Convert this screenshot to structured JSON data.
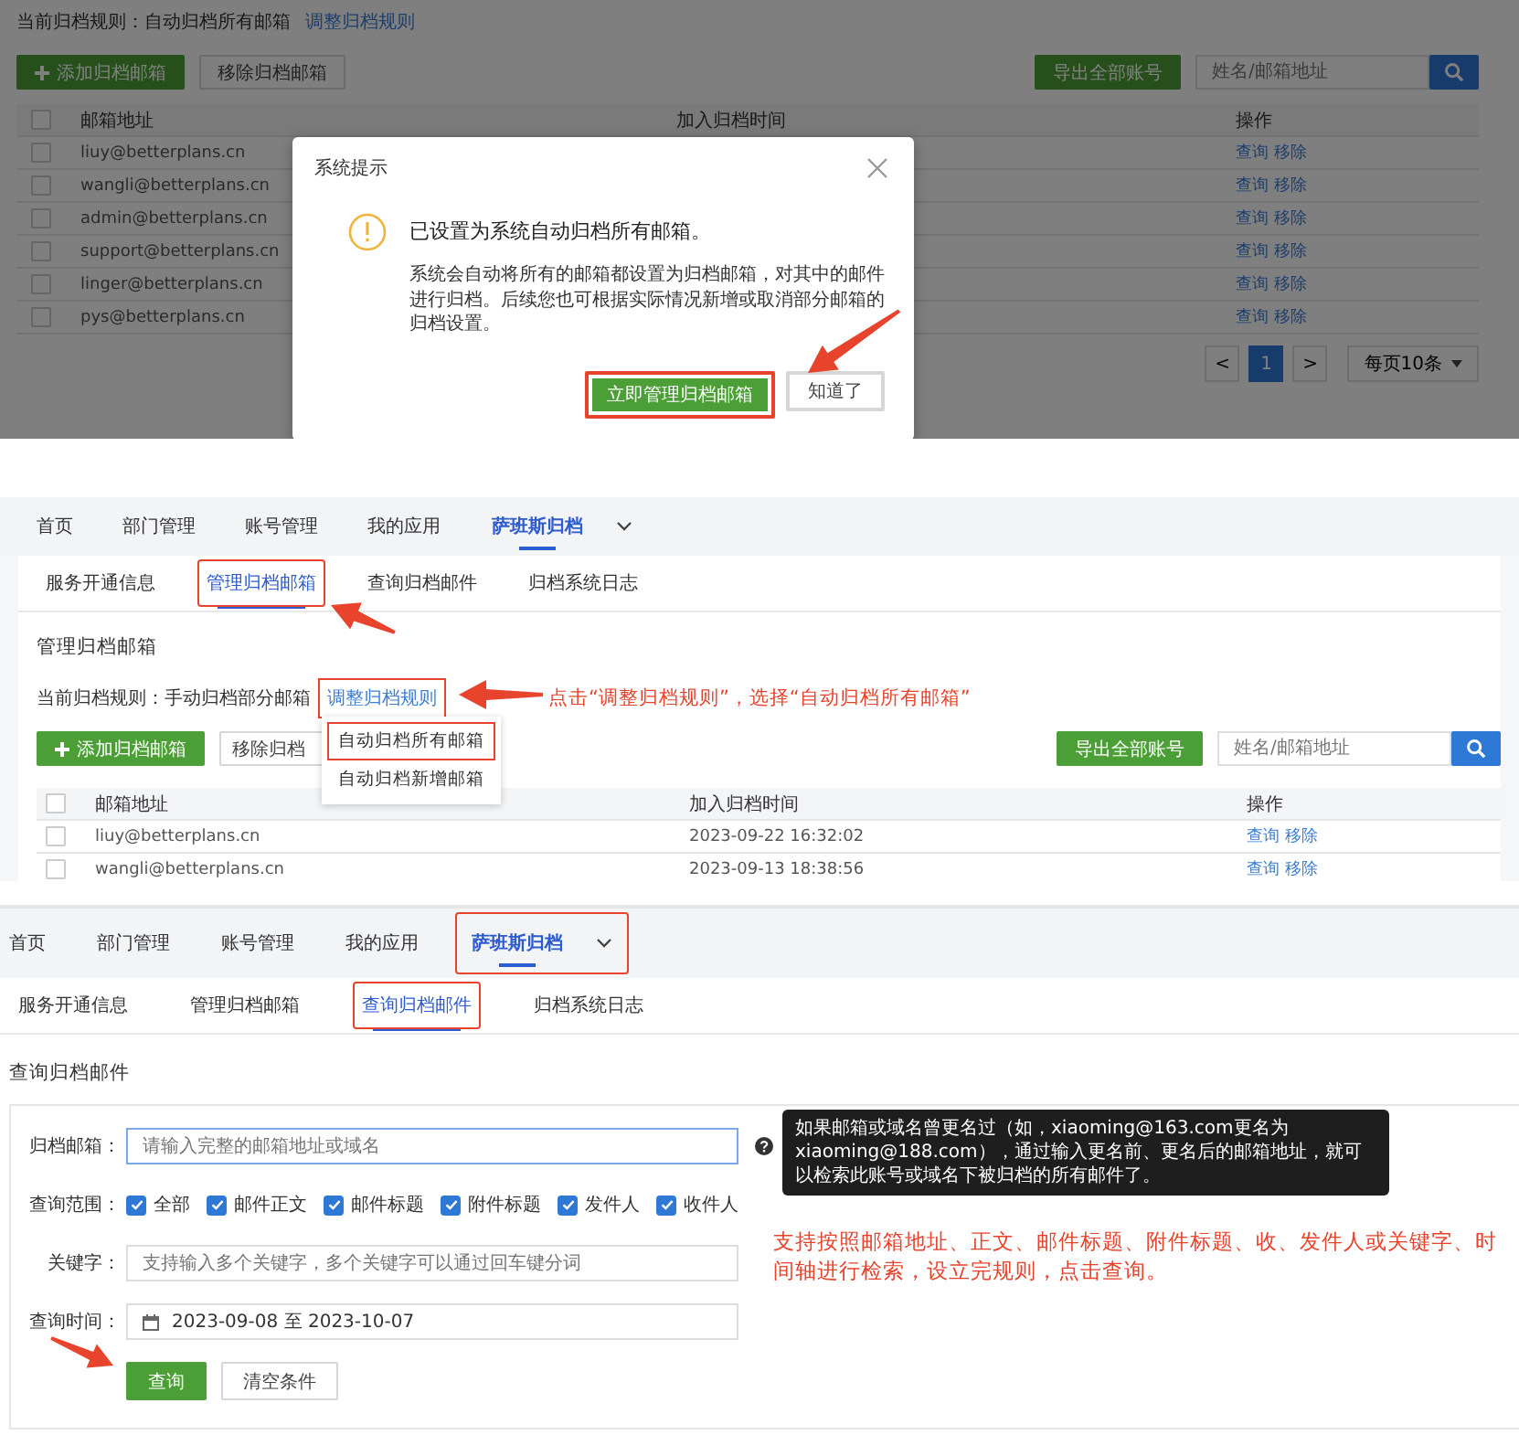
{
  "dialog_screen": {
    "rule": {
      "text": "当前归档规则：自动归档所有邮箱",
      "link": "调整归档规则"
    },
    "toolbar": {
      "add": "添加归档邮箱",
      "remove": "移除归档邮箱",
      "export": "导出全部账号",
      "search_placeholder": "姓名/邮箱地址"
    },
    "table": {
      "all_checked": false,
      "columns": [
        "邮箱地址",
        "加入归档时间",
        "操作"
      ],
      "rows": [
        {
          "checked": false,
          "email": "liuy@betterplans.cn",
          "actions": [
            "查询",
            "移除"
          ]
        },
        {
          "checked": false,
          "email": "wangli@betterplans.cn",
          "actions": [
            "查询",
            "移除"
          ]
        },
        {
          "checked": false,
          "email": "admin@betterplans.cn",
          "actions": [
            "查询",
            "移除"
          ]
        },
        {
          "checked": false,
          "email": "support@betterplans.cn",
          "actions": [
            "查询",
            "移除"
          ]
        },
        {
          "checked": false,
          "email": "linger@betterplans.cn",
          "actions": [
            "查询",
            "移除"
          ]
        },
        {
          "checked": false,
          "email": "pys@betterplans.cn",
          "actions": [
            "查询",
            "移除"
          ]
        }
      ]
    },
    "pagination": {
      "prev": "<",
      "pages": [
        {
          "label": "1",
          "selected": true
        }
      ],
      "next": ">",
      "page_size": "每页10条"
    },
    "dialog": {
      "title": "系统提示",
      "heading": "已设置为系统自动归档所有邮箱。",
      "message": "系统会自动将所有的邮箱都设置为归档邮箱，对其中的邮件进行归档。后续您也可根据实际情况新增或取消部分邮箱的归档设置。",
      "buttons": [
        {
          "label": "立即管理归档邮箱",
          "kind": "primary",
          "highlighted": true
        },
        {
          "label": "知道了",
          "kind": "default",
          "highlighted": false
        }
      ]
    }
  },
  "rule_screen": {
    "nav": {
      "tabs": [
        {
          "label": "首页",
          "selected": false
        },
        {
          "label": "部门管理",
          "selected": false
        },
        {
          "label": "账号管理",
          "selected": false
        },
        {
          "label": "我的应用",
          "selected": false
        },
        {
          "label": "萨班斯归档",
          "selected": true
        }
      ]
    },
    "subtabs": [
      {
        "label": "服务开通信息",
        "selected": false,
        "highlighted": false
      },
      {
        "label": "管理归档邮箱",
        "selected": true,
        "highlighted": true
      },
      {
        "label": "查询归档邮件",
        "selected": false,
        "highlighted": false
      },
      {
        "label": "归档系统日志",
        "selected": false,
        "highlighted": false
      }
    ],
    "heading": "管理归档邮箱",
    "rule": {
      "text": "当前归档规则：手动归档部分邮箱",
      "link": "调整归档规则",
      "link_highlighted": true
    },
    "annotation": "点击“调整归档规则”，选择“自动归档所有邮箱”",
    "dropdown": [
      {
        "label": "自动归档所有邮箱",
        "highlighted": true
      },
      {
        "label": "自动归档新增邮箱",
        "highlighted": false
      }
    ],
    "toolbar": {
      "add": "添加归档邮箱",
      "remove": "移除归档",
      "export": "导出全部账号",
      "search_placeholder": "姓名/邮箱地址"
    },
    "table": {
      "all_checked": false,
      "columns": [
        "邮箱地址",
        "加入归档时间",
        "操作"
      ],
      "rows": [
        {
          "checked": false,
          "email": "liuy@betterplans.cn",
          "time": "2023-09-22 16:32:02",
          "actions": [
            "查询",
            "移除"
          ]
        },
        {
          "checked": false,
          "email": "wangli@betterplans.cn",
          "time": "2023-09-13 18:38:56",
          "actions": [
            "查询",
            "移除"
          ]
        }
      ]
    }
  },
  "search_screen": {
    "nav": {
      "highlighted": true,
      "tabs": [
        {
          "label": "首页",
          "selected": false
        },
        {
          "label": "部门管理",
          "selected": false
        },
        {
          "label": "账号管理",
          "selected": false
        },
        {
          "label": "我的应用",
          "selected": false
        },
        {
          "label": "萨班斯归档",
          "selected": true
        }
      ]
    },
    "subtabs": [
      {
        "label": "服务开通信息",
        "selected": false,
        "highlighted": false
      },
      {
        "label": "管理归档邮箱",
        "selected": false,
        "highlighted": false
      },
      {
        "label": "查询归档邮件",
        "selected": true,
        "highlighted": true
      },
      {
        "label": "归档系统日志",
        "selected": false,
        "highlighted": false
      }
    ],
    "heading": "查询归档邮件",
    "form": {
      "rows": [
        {
          "kind": "input",
          "label": "归档邮箱：",
          "placeholder": "请输入完整的邮箱地址或域名",
          "help": true
        },
        {
          "kind": "checks",
          "label": "查询范围：",
          "options": [
            {
              "label": "全部",
              "checked": true
            },
            {
              "label": "邮件正文",
              "checked": true
            },
            {
              "label": "邮件标题",
              "checked": true
            },
            {
              "label": "附件标题",
              "checked": true
            },
            {
              "label": "发件人",
              "checked": true
            },
            {
              "label": "收件人",
              "checked": true
            }
          ]
        },
        {
          "kind": "input",
          "label": "关键字：",
          "placeholder": "支持输入多个关键字，多个关键字可以通过回车键分词",
          "help": false
        },
        {
          "kind": "date",
          "label": "查询时间：",
          "value": "2023-09-08 至 2023-10-07"
        }
      ],
      "buttons": [
        {
          "label": "查询",
          "kind": "primary"
        },
        {
          "label": "清空条件",
          "kind": "default"
        }
      ]
    },
    "tooltip": "如果邮箱或域名曾更名过（如，xiaoming@163.com更名为xiaoming@188.com），通过输入更名前、更名后的邮箱地址，就可以检索此账号或域名下被归档的所有邮件了。",
    "annotation": "支持按照邮箱地址、正文、邮件标题、附件标题、收、发件人或关键字、时间轴进行检索，设立完规则，点击查询。"
  }
}
